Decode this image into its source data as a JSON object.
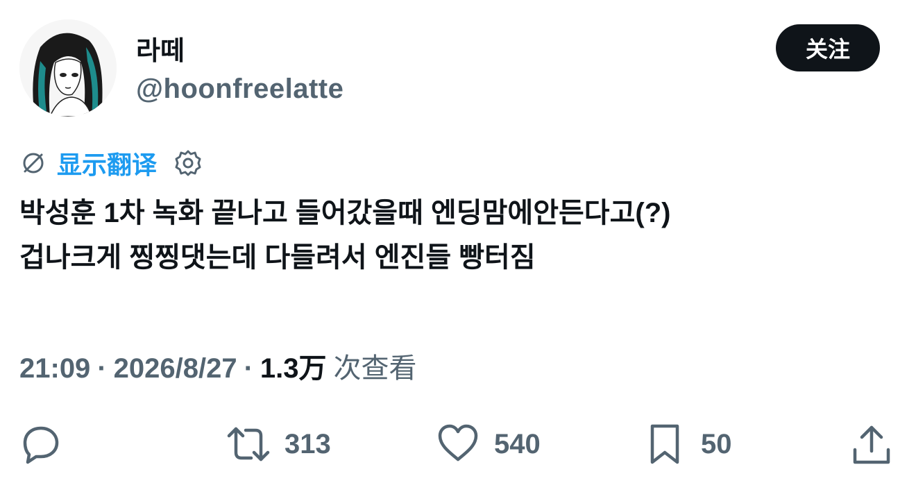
{
  "user": {
    "display_name": "라떼",
    "handle": "@hoonfreelatte",
    "follow_label": "关注"
  },
  "translate": {
    "label": "显示翻译"
  },
  "tweet": {
    "line1": "박성훈 1차 녹화 끝나고 들어갔을때 엔딩맘에안든다고(?)",
    "line2": "겁나크게 찡찡댓는데 다들려서 엔진들 빵터짐"
  },
  "meta": {
    "time": "21:09",
    "sep": "·",
    "date": "2026/8/27",
    "views": "1.3万",
    "views_label": "次查看"
  },
  "actions": {
    "reply_count": "",
    "retweet_count": "313",
    "like_count": "540",
    "bookmark_count": "50"
  },
  "colors": {
    "accent": "#1d9bf0",
    "text": "#0f1419",
    "secondary": "#536471"
  }
}
